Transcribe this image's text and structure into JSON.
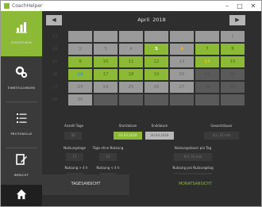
{
  "window": {
    "title": "CoachHelper",
    "controls": [
      "–",
      "□",
      "✕"
    ]
  },
  "sidebar": {
    "items": [
      {
        "label": "STATISTIKEN",
        "icon": "bar-chart-icon"
      },
      {
        "label": "EINSTELLUNGEN",
        "icon": "settings-icon"
      },
      {
        "label": "PROTOKOLLE",
        "icon": "list-icon"
      },
      {
        "label": "BERICHT",
        "icon": "edit-icon"
      }
    ],
    "home_icon": "home-icon"
  },
  "calendar": {
    "prev": "◀",
    "next": "▶",
    "month": "April",
    "year": "2018",
    "weeks": [
      "13",
      "14",
      "15",
      "16",
      "17",
      "18"
    ],
    "rows": [
      [
        {
          "d": "",
          "s": "hdr"
        },
        {
          "d": "",
          "s": "hdr"
        },
        {
          "d": "",
          "s": "hdr"
        },
        {
          "d": "",
          "s": "hdr"
        },
        {
          "d": "",
          "s": "hdr"
        },
        {
          "d": "",
          "s": "hdr"
        },
        {
          "d": "1",
          "s": "normal"
        }
      ],
      [
        {
          "d": "2",
          "s": "normal"
        },
        {
          "d": "3",
          "s": "normal"
        },
        {
          "d": "4",
          "s": "normal"
        },
        {
          "d": "5",
          "s": "used today"
        },
        {
          "d": "6",
          "s": "normal orange"
        },
        {
          "d": "7",
          "s": "used"
        },
        {
          "d": "8",
          "s": "used"
        }
      ],
      [
        {
          "d": "9",
          "s": "used"
        },
        {
          "d": "10",
          "s": "used"
        },
        {
          "d": "11",
          "s": "used"
        },
        {
          "d": "12",
          "s": "used"
        },
        {
          "d": "13",
          "s": "normal"
        },
        {
          "d": "14",
          "s": "used orange"
        },
        {
          "d": "15",
          "s": "used"
        }
      ],
      [
        {
          "d": "16",
          "s": "used teal"
        },
        {
          "d": "17",
          "s": "used"
        },
        {
          "d": "18",
          "s": "used"
        },
        {
          "d": "19",
          "s": "used"
        },
        {
          "d": "20",
          "s": "normal"
        },
        {
          "d": "21",
          "s": "out"
        },
        {
          "d": "22",
          "s": "out"
        }
      ],
      [
        {
          "d": "23",
          "s": "normal"
        },
        {
          "d": "24",
          "s": "normal"
        },
        {
          "d": "25",
          "s": "normal"
        },
        {
          "d": "26",
          "s": "normal"
        },
        {
          "d": "27",
          "s": "normal"
        },
        {
          "d": "28",
          "s": "out"
        },
        {
          "d": "29",
          "s": "out"
        }
      ],
      [
        {
          "d": "30",
          "s": "normal"
        },
        {
          "d": "",
          "s": "out"
        },
        {
          "d": "",
          "s": "out"
        },
        {
          "d": "",
          "s": "out"
        },
        {
          "d": "",
          "s": "out"
        },
        {
          "d": "",
          "s": "out"
        },
        {
          "d": "",
          "s": "out"
        }
      ]
    ]
  },
  "stats": {
    "anzahl_tage_label": "Anzahl Tage",
    "anzahl_tage_value": "30",
    "startdatum_label": "Startdatum",
    "startdatum_value": "01.04.2018",
    "enddatum_label": "Enddatum",
    "enddatum_value": "30.04.2018",
    "gesamtdauer_label": "Gesamtdauer",
    "gesamtdauer_value": "4 h, 15 min",
    "nutzungstage_label": "Nutzungstage",
    "nutzungstage_value": "17",
    "tage_ohne_label": "Tage ohne Nutzung",
    "tage_ohne_value": "13",
    "nutzungsdauer_tag_label": "Nutzungsdauer pro Tag",
    "nutzungsdauer_tag_value": "0 h, 15 min",
    "gt_label": "Nutzung > 4 h",
    "gt_value": "0",
    "lt_label": "Nutzung < 4 h",
    "lt_value": "17",
    "pro_nutzungstag_label": "Nutzung pro Nutzungstag",
    "pro_nutzungstag_value": "0 h, 15 min"
  },
  "tabs": {
    "tagesansicht": "TAGESANSICHT",
    "monatsansicht": "MONATSANSICHT"
  },
  "colors": {
    "accent": "#8cb936",
    "sidebar": "#3a3a3a",
    "background": "#2e2e2e"
  }
}
